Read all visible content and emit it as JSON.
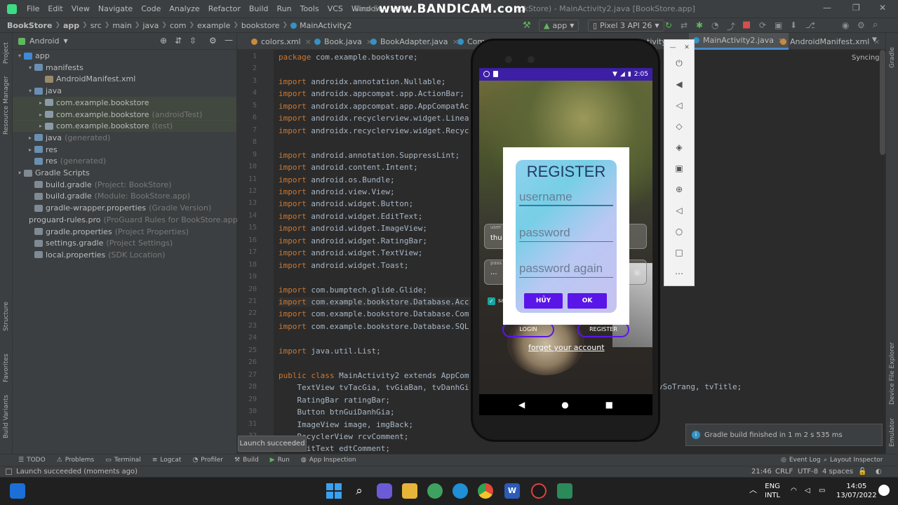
{
  "watermark": "www.BANDICAM.com",
  "menu": [
    "File",
    "Edit",
    "View",
    "Navigate",
    "Code",
    "Analyze",
    "Refactor",
    "Build",
    "Run",
    "Tools",
    "VCS",
    "Window",
    "Help"
  ],
  "window_title": "BookStore - MainActivity2.java [BookStore.app]",
  "window_title_left": "BookS",
  "window_title_right": "ookStore) - MainActivity2.java [BookStore.app]",
  "breadcrumb": [
    "BookStore",
    "app",
    "src",
    "main",
    "java",
    "com",
    "example",
    "bookstore",
    "MainActivity2"
  ],
  "toolbar": {
    "module": "app",
    "device": "Pixel 3 API 26"
  },
  "project_panel": {
    "view": "Android",
    "tree": [
      {
        "label": "app",
        "hint": "",
        "depth": 0,
        "arrow": "▾",
        "color": "#3d8bd6"
      },
      {
        "label": "manifests",
        "hint": "",
        "depth": 1,
        "arrow": "▾",
        "color": "#6a8fb3"
      },
      {
        "label": "AndroidManifest.xml",
        "hint": "",
        "depth": 2,
        "arrow": "",
        "color": "#9a8a6a"
      },
      {
        "label": "java",
        "hint": "",
        "depth": 1,
        "arrow": "▾",
        "color": "#6a8fb3"
      },
      {
        "label": "com.example.bookstore",
        "hint": "",
        "depth": 2,
        "arrow": "▸",
        "color": "#8b9aa8"
      },
      {
        "label": "com.example.bookstore",
        "hint": "(androidTest)",
        "depth": 2,
        "arrow": "▸",
        "color": "#8b9aa8"
      },
      {
        "label": "com.example.bookstore",
        "hint": "(test)",
        "depth": 2,
        "arrow": "▸",
        "color": "#8b9aa8"
      },
      {
        "label": "java",
        "hint": "(generated)",
        "depth": 1,
        "arrow": "▸",
        "color": "#6a8fb3"
      },
      {
        "label": "res",
        "hint": "",
        "depth": 1,
        "arrow": "▸",
        "color": "#6a8fb3"
      },
      {
        "label": "res",
        "hint": "(generated)",
        "depth": 1,
        "arrow": "",
        "color": "#6a8fb3"
      },
      {
        "label": "Gradle Scripts",
        "hint": "",
        "depth": 0,
        "arrow": "▾",
        "color": "#7f8a94"
      },
      {
        "label": "build.gradle",
        "hint": "(Project: BookStore)",
        "depth": 1,
        "arrow": "",
        "color": "#7f8a94"
      },
      {
        "label": "build.gradle",
        "hint": "(Module: BookStore.app)",
        "depth": 1,
        "arrow": "",
        "color": "#7f8a94"
      },
      {
        "label": "gradle-wrapper.properties",
        "hint": "(Gradle Version)",
        "depth": 1,
        "arrow": "",
        "color": "#7f8a94"
      },
      {
        "label": "proguard-rules.pro",
        "hint": "(ProGuard Rules for BookStore.app)",
        "depth": 1,
        "arrow": "",
        "color": "#7f8a94"
      },
      {
        "label": "gradle.properties",
        "hint": "(Project Properties)",
        "depth": 1,
        "arrow": "",
        "color": "#7f8a94"
      },
      {
        "label": "settings.gradle",
        "hint": "(Project Settings)",
        "depth": 1,
        "arrow": "",
        "color": "#7f8a94"
      },
      {
        "label": "local.properties",
        "hint": "(SDK Location)",
        "depth": 1,
        "arrow": "",
        "color": "#7f8a94"
      }
    ]
  },
  "left_strip": [
    "Project",
    "Resource Manager",
    "Structure",
    "Favorites",
    "Build Variants"
  ],
  "right_strip": [
    "Gradle",
    "Device File Explorer",
    "Emulator"
  ],
  "tabs": [
    "colors.xml",
    "Book.java",
    "BookAdapter.java",
    "Comm",
    "tivity",
    "MainActivity2.java",
    "AndroidManifest.xml"
  ],
  "syncing": "Syncing...",
  "code_lines": [
    {
      "n": "1",
      "t": "package com.example.bookstore;"
    },
    {
      "n": "2",
      "t": ""
    },
    {
      "n": "3",
      "t": "import androidx.annotation.Nullable;"
    },
    {
      "n": "4",
      "t": "import androidx.appcompat.app.ActionBar;"
    },
    {
      "n": "5",
      "t": "import androidx.appcompat.app.AppCompatAc"
    },
    {
      "n": "6",
      "t": "import androidx.recyclerview.widget.Linea"
    },
    {
      "n": "7",
      "t": "import androidx.recyclerview.widget.Recyc"
    },
    {
      "n": "8",
      "t": ""
    },
    {
      "n": "9",
      "t": "import android.annotation.SuppressLint;"
    },
    {
      "n": "10",
      "t": "import android.content.Intent;"
    },
    {
      "n": "11",
      "t": "import android.os.Bundle;"
    },
    {
      "n": "12",
      "t": "import android.view.View;"
    },
    {
      "n": "13",
      "t": "import android.widget.Button;"
    },
    {
      "n": "14",
      "t": "import android.widget.EditText;"
    },
    {
      "n": "15",
      "t": "import android.widget.ImageView;"
    },
    {
      "n": "16",
      "t": "import android.widget.RatingBar;"
    },
    {
      "n": "17",
      "t": "import android.widget.TextView;"
    },
    {
      "n": "18",
      "t": "import android.widget.Toast;"
    },
    {
      "n": "19",
      "t": ""
    },
    {
      "n": "20",
      "t": "import com.bumptech.glide.Glide;"
    },
    {
      "n": "21",
      "t": "import com.example.bookstore.Database.Acc"
    },
    {
      "n": "22",
      "t": "import com.example.bookstore.Database.Com"
    },
    {
      "n": "23",
      "t": "import com.example.bookstore.Database.SQL"
    },
    {
      "n": "24",
      "t": ""
    },
    {
      "n": "25",
      "t": "import java.util.List;"
    },
    {
      "n": "26",
      "t": ""
    },
    {
      "n": "27",
      "t": "public class MainActivity2 extends AppCom"
    },
    {
      "n": "28",
      "t": "    TextView tvTacGia, tvGiaBan, tvDanhGi"
    },
    {
      "n": "29",
      "t": "    RatingBar ratingBar;"
    },
    {
      "n": "30",
      "t": "    Button btnGuiDanhGia;"
    },
    {
      "n": "31",
      "t": "    ImageView image, imgBack;"
    },
    {
      "n": "32",
      "t": "    RecyclerView rcvComment;"
    },
    {
      "n": "33",
      "t": "    EditText edtComment;"
    }
  ],
  "code_tail_28": "vSoTrang, tvTitle;",
  "phone": {
    "time": "2:05",
    "dialog": {
      "title": "REGISTER",
      "username_placeholder": "username",
      "password_placeholder": "password",
      "password_again_placeholder": "password again",
      "cancel": "HỦY",
      "ok": "OK"
    },
    "behind": {
      "user_hint": "user",
      "user_value": "thu",
      "pass_hint": "pass",
      "pass_value": "...",
      "remember": "sa",
      "login": "LOGIN",
      "register": "REGISTER",
      "forget": "forget your account"
    }
  },
  "notification": "Gradle build finished in 1 m 2 s 535 ms",
  "toast": "Launch succeeded",
  "tool_windows": [
    "TODO",
    "Problems",
    "Terminal",
    "Logcat",
    "Profiler",
    "Build",
    "Run",
    "App Inspection"
  ],
  "right_tools": [
    "Event Log",
    "Layout Inspector"
  ],
  "status": {
    "message": "Launch succeeded (moments ago)",
    "position": "21:46",
    "line_sep": "CRLF",
    "encoding": "UTF-8",
    "indent": "4 spaces"
  },
  "taskbar": {
    "lang1": "ENG",
    "lang2": "INTL",
    "time": "14:05",
    "date": "13/07/2022"
  }
}
